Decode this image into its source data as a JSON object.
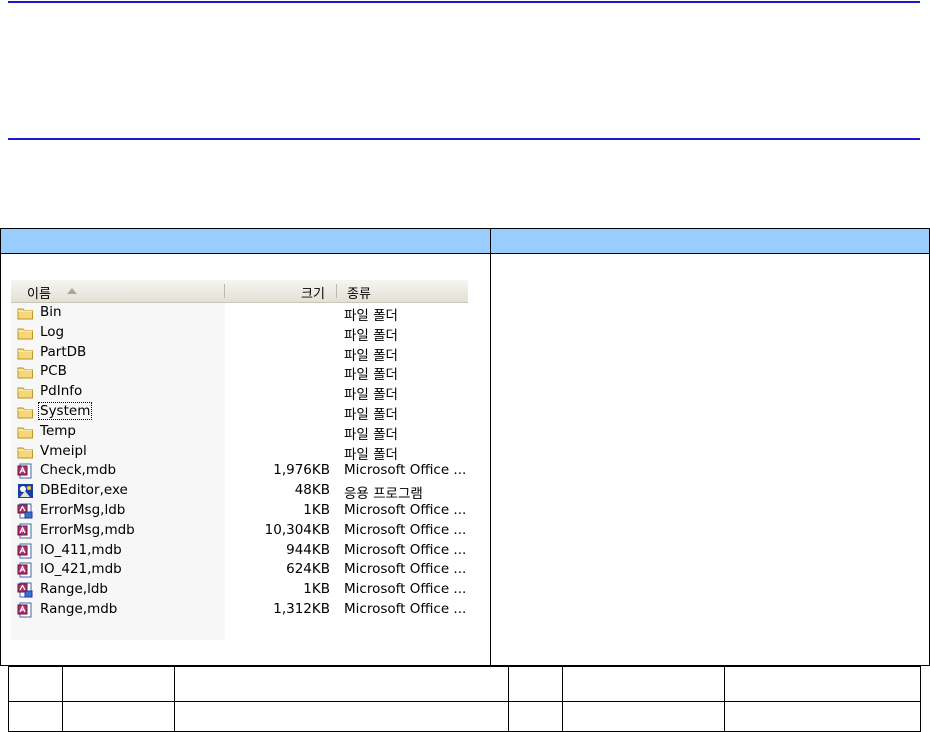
{
  "explorer": {
    "columns": {
      "name": "이름",
      "size": "크기",
      "type": "종류"
    },
    "rows": [
      {
        "name": "Bin",
        "size": "",
        "type": "파일 폴더",
        "icon": "folder-icon"
      },
      {
        "name": "Log",
        "size": "",
        "type": "파일 폴더",
        "icon": "folder-icon"
      },
      {
        "name": "PartDB",
        "size": "",
        "type": "파일 폴더",
        "icon": "folder-icon"
      },
      {
        "name": "PCB",
        "size": "",
        "type": "파일 폴더",
        "icon": "folder-icon"
      },
      {
        "name": "PdInfo",
        "size": "",
        "type": "파일 폴더",
        "icon": "folder-icon"
      },
      {
        "name": "System",
        "size": "",
        "type": "파일 폴더",
        "icon": "folder-icon",
        "focused": true
      },
      {
        "name": "Temp",
        "size": "",
        "type": "파일 폴더",
        "icon": "folder-icon"
      },
      {
        "name": "Vmeipl",
        "size": "",
        "type": "파일 폴더",
        "icon": "folder-icon"
      },
      {
        "name": "Check,mdb",
        "size": "1,976KB",
        "type": "Microsoft Office ...",
        "icon": "access-db-icon"
      },
      {
        "name": "DBEditor,exe",
        "size": "48KB",
        "type": "응용 프로그램",
        "icon": "application-icon"
      },
      {
        "name": "ErrorMsg,ldb",
        "size": "1KB",
        "type": "Microsoft Office ...",
        "icon": "access-lock-icon"
      },
      {
        "name": "ErrorMsg,mdb",
        "size": "10,304KB",
        "type": "Microsoft Office ...",
        "icon": "access-db-icon"
      },
      {
        "name": "IO_411,mdb",
        "size": "944KB",
        "type": "Microsoft Office ...",
        "icon": "access-db-icon"
      },
      {
        "name": "IO_421,mdb",
        "size": "624KB",
        "type": "Microsoft Office ...",
        "icon": "access-db-icon"
      },
      {
        "name": "Range,ldb",
        "size": "1KB",
        "type": "Microsoft Office ...",
        "icon": "access-lock-icon"
      },
      {
        "name": "Range,mdb",
        "size": "1,312KB",
        "type": "Microsoft Office ...",
        "icon": "access-db-icon"
      }
    ]
  },
  "colors": {
    "rule": "#1a1acc",
    "table_header": "#99ccff",
    "folder": "#f5d77a"
  }
}
